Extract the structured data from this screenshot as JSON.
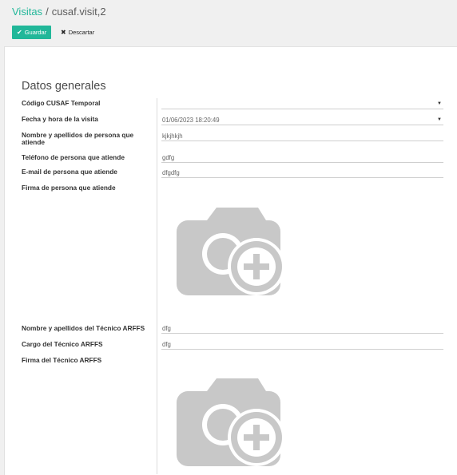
{
  "breadcrumb": {
    "parent": "Visitas",
    "separator": "/",
    "current": "cusaf.visit,2"
  },
  "toolbar": {
    "save_label": "Guardar",
    "discard_label": "Descartar"
  },
  "section": {
    "title": "Datos generales"
  },
  "fields": {
    "codigo": {
      "label": "Código CUSAF Temporal",
      "value": ""
    },
    "fecha": {
      "label": "Fecha y hora de la visita",
      "value": "01/06/2023 18:20:49"
    },
    "nombre": {
      "label": "Nombre y apellidos de persona que atiende",
      "value": "kjkjhkjh"
    },
    "telefono": {
      "label": "Teléfono de persona que atiende",
      "value": "gdfg"
    },
    "email": {
      "label": "E-mail de persona que atiende",
      "value": "dfgdfg"
    },
    "firma_persona": {
      "label": "Firma de persona que atiende"
    },
    "tecnico": {
      "label": "Nombre y apellidos del Técnico ARFFS",
      "value": "dfg"
    },
    "cargo": {
      "label": "Cargo del Técnico ARFFS",
      "value": "dfg"
    },
    "firma_tecnico": {
      "label": "Firma del Técnico ARFFS"
    }
  },
  "icons": {
    "save": "check-icon",
    "discard": "x-icon",
    "signature": "camera-plus-icon",
    "dropdown": "caret-down-icon"
  },
  "colors": {
    "accent": "#21b799",
    "placeholder": "#c8c8c8"
  }
}
